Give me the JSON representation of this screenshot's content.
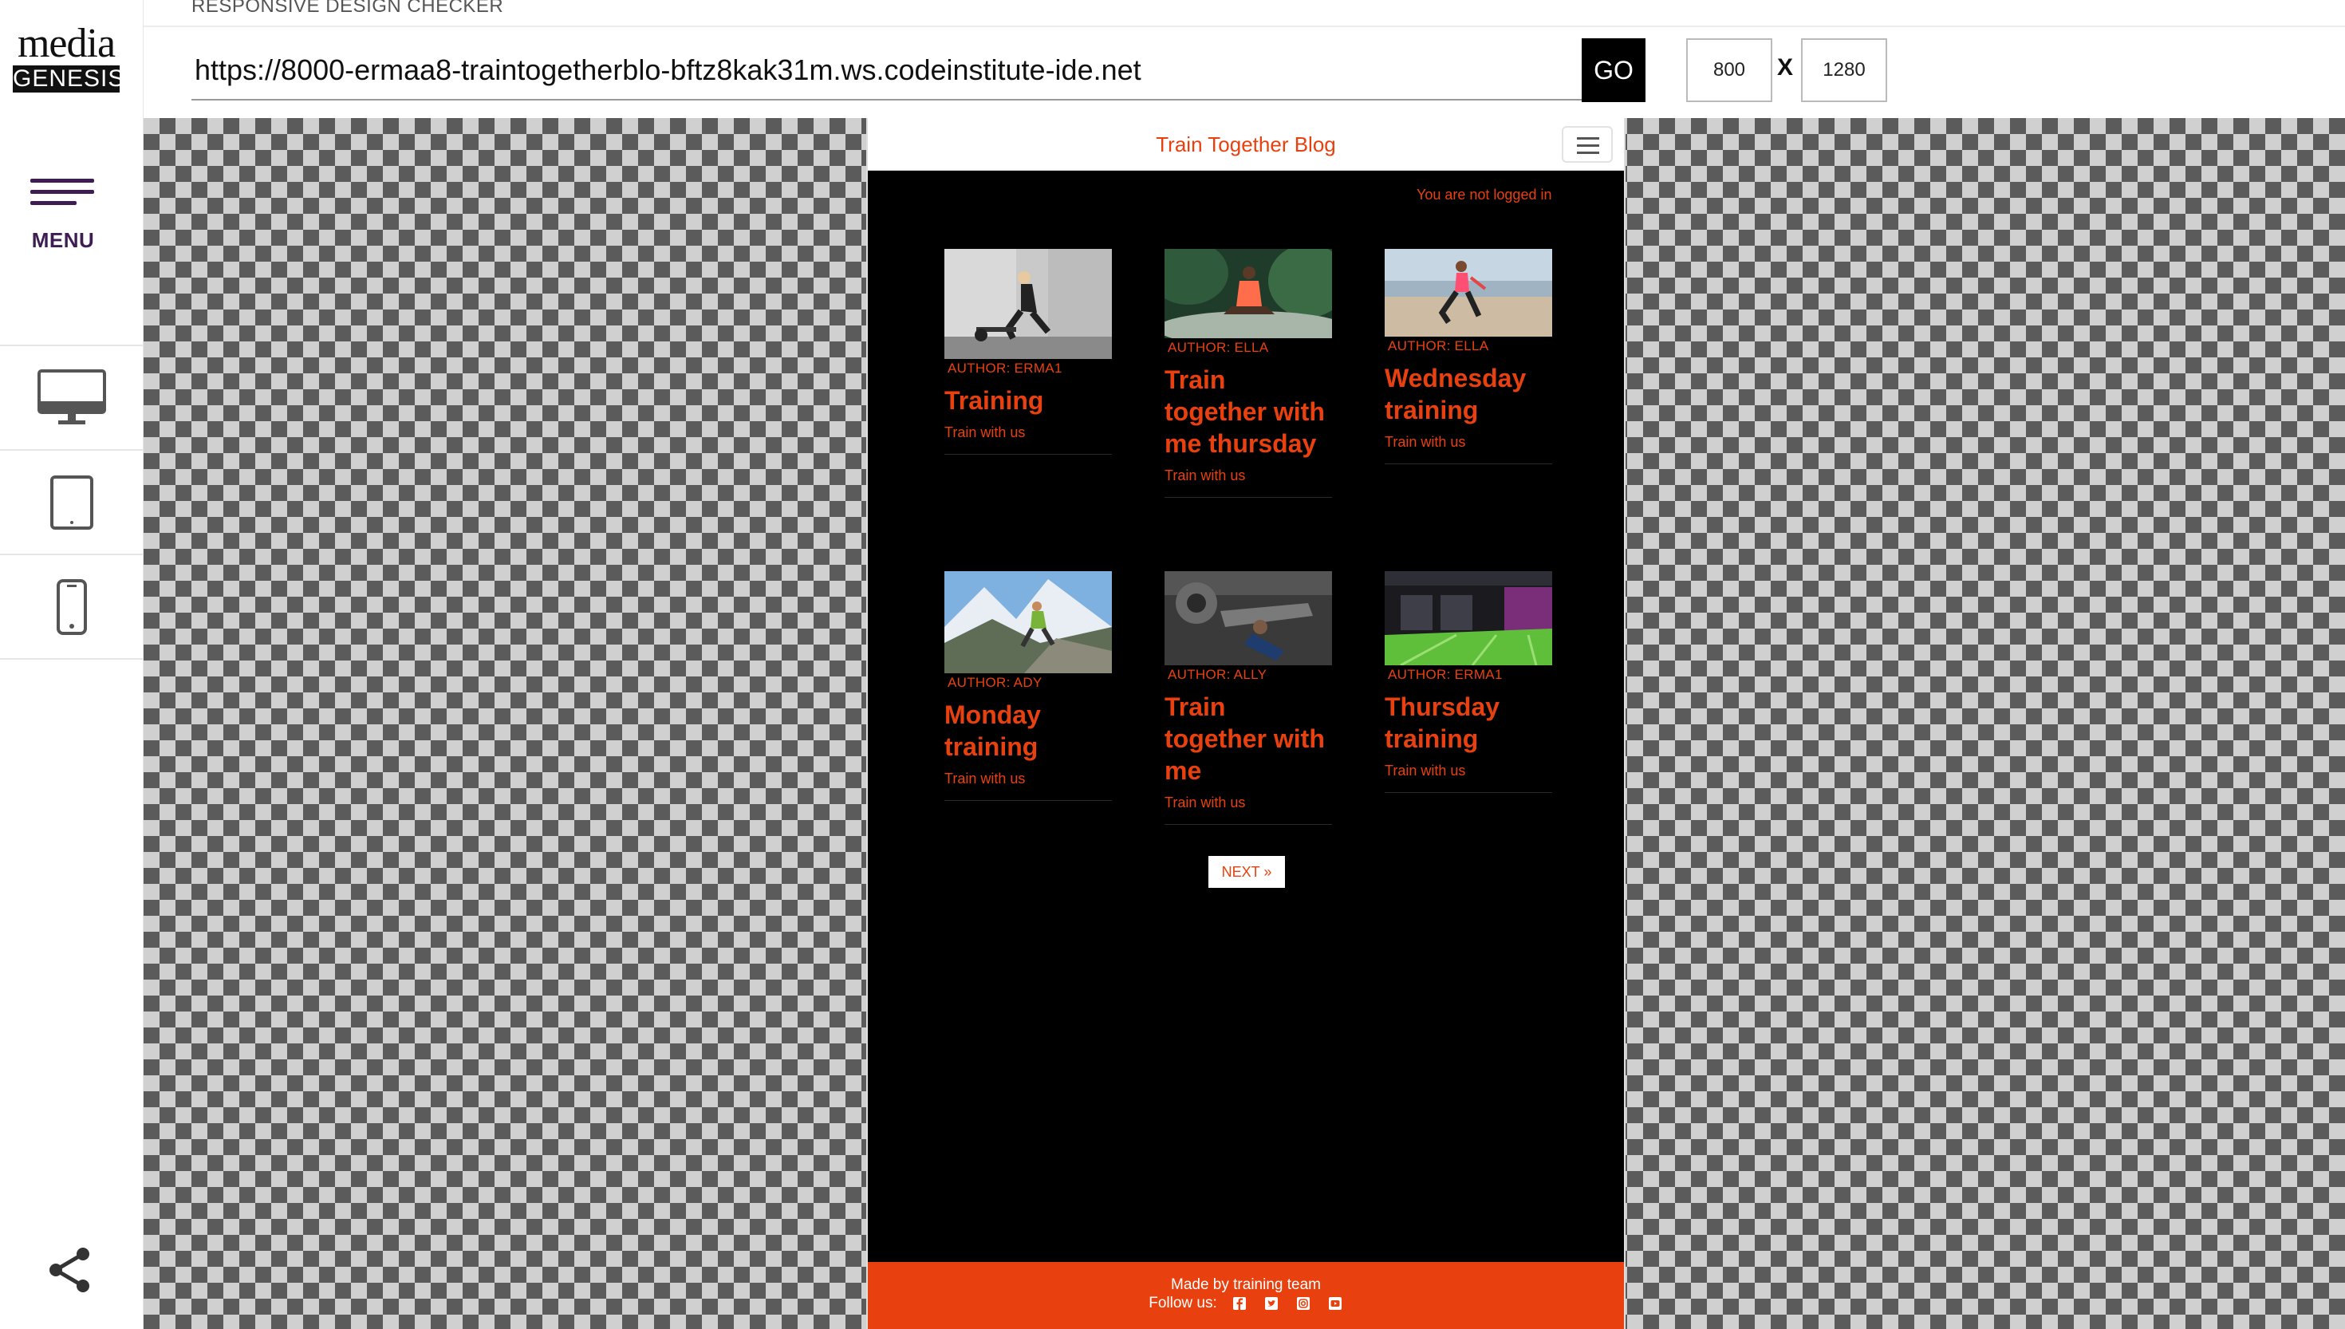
{
  "sidebar": {
    "logo_top": "media",
    "logo_bottom": "GENESIS",
    "menu_label": "MENU",
    "devices": [
      "desktop-icon",
      "tablet-icon",
      "phone-icon"
    ],
    "share_icon": "share-icon",
    "accent": "#3d1d52"
  },
  "topbar": {
    "title": "RESPONSIVE DESIGN CHECKER",
    "url": "https://8000-ermaa8-traintogetherblo-bftz8kak31m.ws.codeinstitute-ide.net",
    "go_label": "GO",
    "width_value": "800",
    "times_label": "X",
    "height_value": "1280"
  },
  "blog": {
    "brand": "Train Together Blog",
    "login_status": "You are not logged in",
    "accent": "#e8410f",
    "posts": [
      {
        "author": "AUTHOR: ERMA1",
        "title": "Training",
        "excerpt": "Train with us"
      },
      {
        "author": "AUTHOR: ELLA",
        "title": "Train together with me thursday",
        "excerpt": "Train with us"
      },
      {
        "author": "AUTHOR: ELLA",
        "title": "Wednesday training",
        "excerpt": "Train with us"
      },
      {
        "author": "AUTHOR: ADY",
        "title": "Monday training",
        "excerpt": "Train with us"
      },
      {
        "author": "AUTHOR: ALLY",
        "title": "Train together with me",
        "excerpt": "Train with us"
      },
      {
        "author": "AUTHOR: ERMA1",
        "title": "Thursday training",
        "excerpt": "Train with us"
      }
    ],
    "next_label": "NEXT »",
    "footer": {
      "made_by": "Made by training team",
      "follow_label": "Follow us:",
      "social_icons": [
        "facebook-icon",
        "twitter-icon",
        "instagram-icon",
        "youtube-icon"
      ]
    }
  }
}
